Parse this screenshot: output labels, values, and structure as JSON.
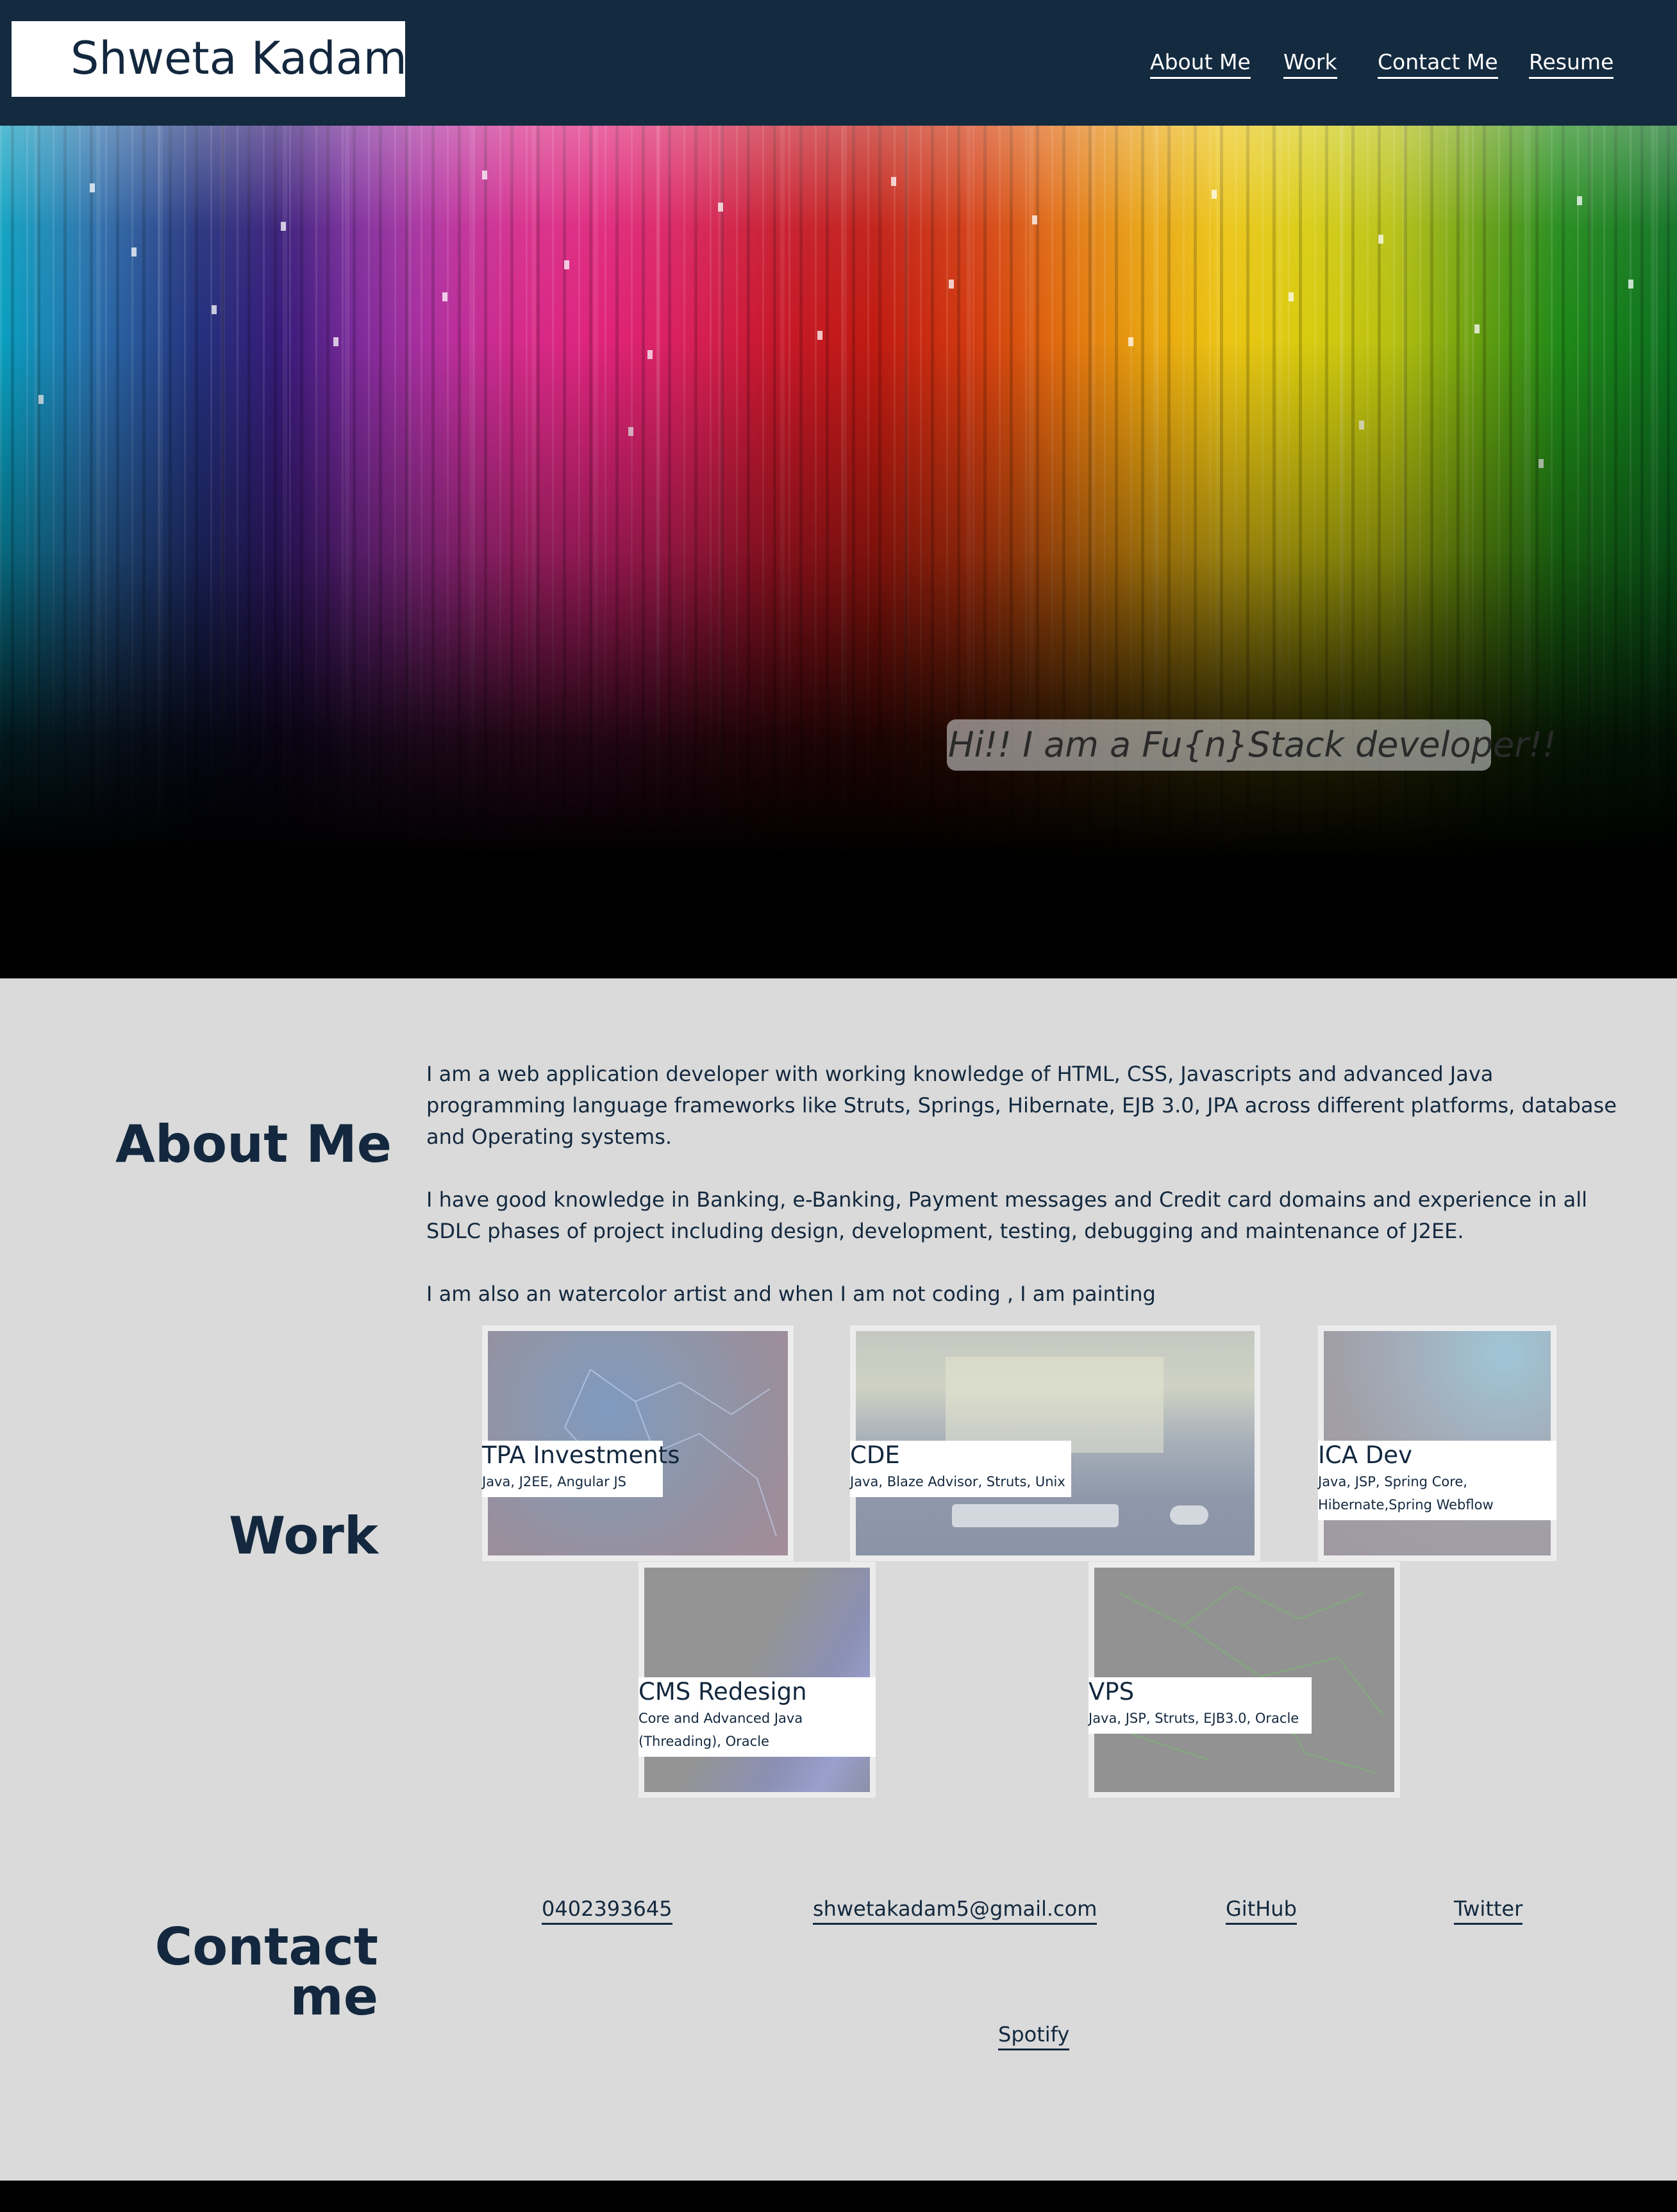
{
  "header": {
    "brand": "Shweta Kadam",
    "nav": [
      "About Me",
      "Work",
      "Contact Me",
      "Resume"
    ]
  },
  "hero": {
    "tagline": "Hi!! I am a Fu{n}Stack developer!!"
  },
  "about": {
    "title": "About Me",
    "paragraphs": [
      "I am a web application developer with working knowledge of HTML, CSS, Javascripts and advanced Java programming language frameworks like Struts, Springs, Hibernate, EJB 3.0, JPA across different platforms, database and Operating systems.",
      "I have good knowledge in Banking, e-Banking, Payment messages and Credit card domains and experience in all SDLC phases of project including design, development, testing, debugging and maintenance of J2EE.",
      "I am also an watercolor artist and when I am not coding , I am painting"
    ]
  },
  "work": {
    "title": "Work",
    "projects": [
      {
        "title": "TPA Investments",
        "tech": "Java, J2EE, Angular JS"
      },
      {
        "title": "CDE",
        "tech": "Java, Blaze Advisor, Struts, Unix"
      },
      {
        "title": "ICA Dev",
        "tech": "Java, JSP, Spring Core, Hibernate,Spring Webflow"
      },
      {
        "title": "CMS Redesign",
        "tech": "Core and Advanced Java (Threading), Oracle"
      },
      {
        "title": "VPS",
        "tech": "Java, JSP, Struts, EJB3.0, Oracle"
      }
    ]
  },
  "contact": {
    "title_line1": "Contact",
    "title_line2": "me",
    "links": [
      "0402393645",
      "shwetakadam5@gmail.com",
      "GitHub",
      "Twitter",
      "Spotify"
    ]
  },
  "colors": {
    "navy": "#132a3f",
    "page_bg": "#dadada",
    "white": "#ffffff",
    "footer": "#000000"
  }
}
